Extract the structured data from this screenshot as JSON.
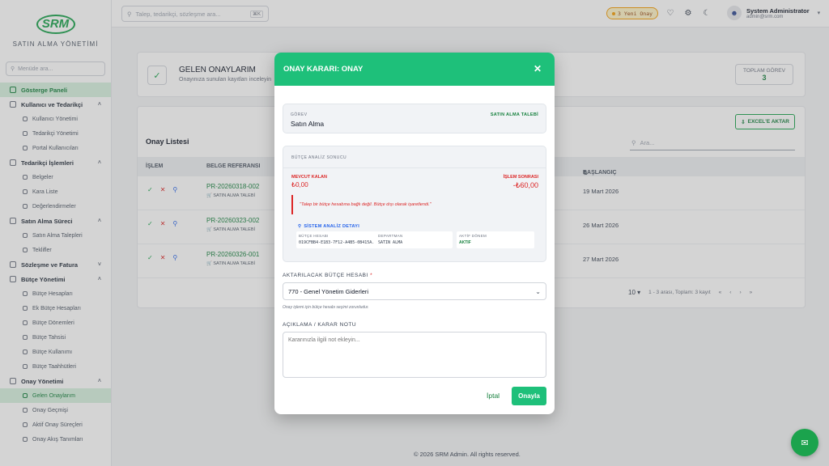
{
  "sidebar": {
    "logo": "SRM",
    "subtitle": "SATIN ALMA YÖNETİMİ",
    "search_placeholder": "Menüde ara...",
    "items": [
      {
        "label": "Gösterge Paneli",
        "level": "top",
        "active": true
      },
      {
        "label": "Kullanıcı ve Tedarikçi",
        "level": "top",
        "chevron": "^"
      },
      {
        "label": "Kullanıcı Yönetimi",
        "level": "sub"
      },
      {
        "label": "Tedarikçi Yönetimi",
        "level": "sub"
      },
      {
        "label": "Portal Kullanıcıları",
        "level": "sub"
      },
      {
        "label": "Tedarikçi İşlemleri",
        "level": "top",
        "chevron": "^"
      },
      {
        "label": "Belgeler",
        "level": "sub"
      },
      {
        "label": "Kara Liste",
        "level": "sub"
      },
      {
        "label": "Değerlendirmeler",
        "level": "sub"
      },
      {
        "label": "Satın Alma Süreci",
        "level": "top",
        "chevron": "^"
      },
      {
        "label": "Satın Alma Talepleri",
        "level": "sub"
      },
      {
        "label": "Teklifler",
        "level": "sub"
      },
      {
        "label": "Sözleşme ve Fatura",
        "level": "top",
        "chevron": "v"
      },
      {
        "label": "Bütçe Yönetimi",
        "level": "top",
        "chevron": "^"
      },
      {
        "label": "Bütçe Hesapları",
        "level": "sub"
      },
      {
        "label": "Ek Bütçe Hesapları",
        "level": "sub"
      },
      {
        "label": "Bütçe Dönemleri",
        "level": "sub"
      },
      {
        "label": "Bütçe Tahsisi",
        "level": "sub"
      },
      {
        "label": "Bütçe Kullanımı",
        "level": "sub"
      },
      {
        "label": "Bütçe Taahhütleri",
        "level": "sub"
      },
      {
        "label": "Onay Yönetimi",
        "level": "top",
        "chevron": "^"
      },
      {
        "label": "Gelen Onaylarım",
        "level": "sub",
        "active": true
      },
      {
        "label": "Onay Geçmişi",
        "level": "sub"
      },
      {
        "label": "Aktif Onay Süreçleri",
        "level": "sub"
      },
      {
        "label": "Onay Akış Tanımları",
        "level": "sub"
      }
    ]
  },
  "topbar": {
    "search_placeholder": "Talep, tedarikçi, sözleşme ara...",
    "shortcut": "⌘K",
    "pending_badge": "3 Yeni Onay",
    "user_name": "System Administrator",
    "user_email": "admin@srm.com"
  },
  "page": {
    "title": "GELEN ONAYLARIM",
    "subtitle": "Onayınıza sunulan kayıtları inceleyin",
    "total_label": "TOPLAM GÖREV",
    "total_value": "3",
    "export_label": "EXCEL'E AKTAR",
    "list_title": "Onay Listesi",
    "list_search_placeholder": "Ara...",
    "columns": [
      "İŞLEM",
      "BELGE REFERANSI",
      "BAŞLANGIÇ"
    ],
    "rows": [
      {
        "ref": "PR-20260318-002",
        "tag": "SATIN ALMA TALEBİ",
        "date": "19 Mart 2026"
      },
      {
        "ref": "PR-20260323-002",
        "tag": "SATIN ALMA TALEBİ",
        "date": "26 Mart 2026"
      },
      {
        "ref": "PR-20260326-001",
        "tag": "SATIN ALMA TALEBİ",
        "date": "27 Mart 2026"
      }
    ],
    "page_size": "10",
    "pager_text": "1 - 3 arası, Toplam: 3 kayıt",
    "footer": "© 2026 SRM Admin. All rights reserved."
  },
  "modal": {
    "title": "ONAY KARARI: ONAY",
    "task_label": "GÖREV",
    "task_value": "Satın Alma",
    "task_tag": "SATIN ALMA TALEBİ",
    "budget_title": "BÜTÇE ANALİZ SONUCU",
    "current_label": "MEVCUT KALAN",
    "current_value": "₺0,00",
    "after_label": "İŞLEM SONRASI",
    "after_value": "-₺60,00",
    "warning": "\"Talep bir bütçe hesabına bağlı değil. Bütçe dışı olarak işaretlendi.\"",
    "analysis_title": "SİSTEM ANALİZ DETAYI",
    "analysis": [
      {
        "label": "BÜTÇE HESABI",
        "value": "019CFBB4-E1B3-7F12-A4B5-0B415A..."
      },
      {
        "label": "DEPARTMAN",
        "value": "SATIN ALMA"
      },
      {
        "label": "AKTİF DÖNEM",
        "value": "AKTİF"
      }
    ],
    "account_label": "AKTARILACAK BÜTÇE HESABI",
    "account_value": "770 - Genel Yönetim Giderleri",
    "account_hint": "Onay işlemi için bütçe hesabı seçimi zorunludur.",
    "note_label": "AÇIKLAMA / KARAR NOTU",
    "note_placeholder": "Kararınızla ilgili not ekleyin...",
    "cancel_label": "İptal",
    "approve_label": "Onayla"
  },
  "colors": {
    "brand": "#1ba34d",
    "modal_header": "#1ec07a",
    "danger": "#dc2626"
  }
}
